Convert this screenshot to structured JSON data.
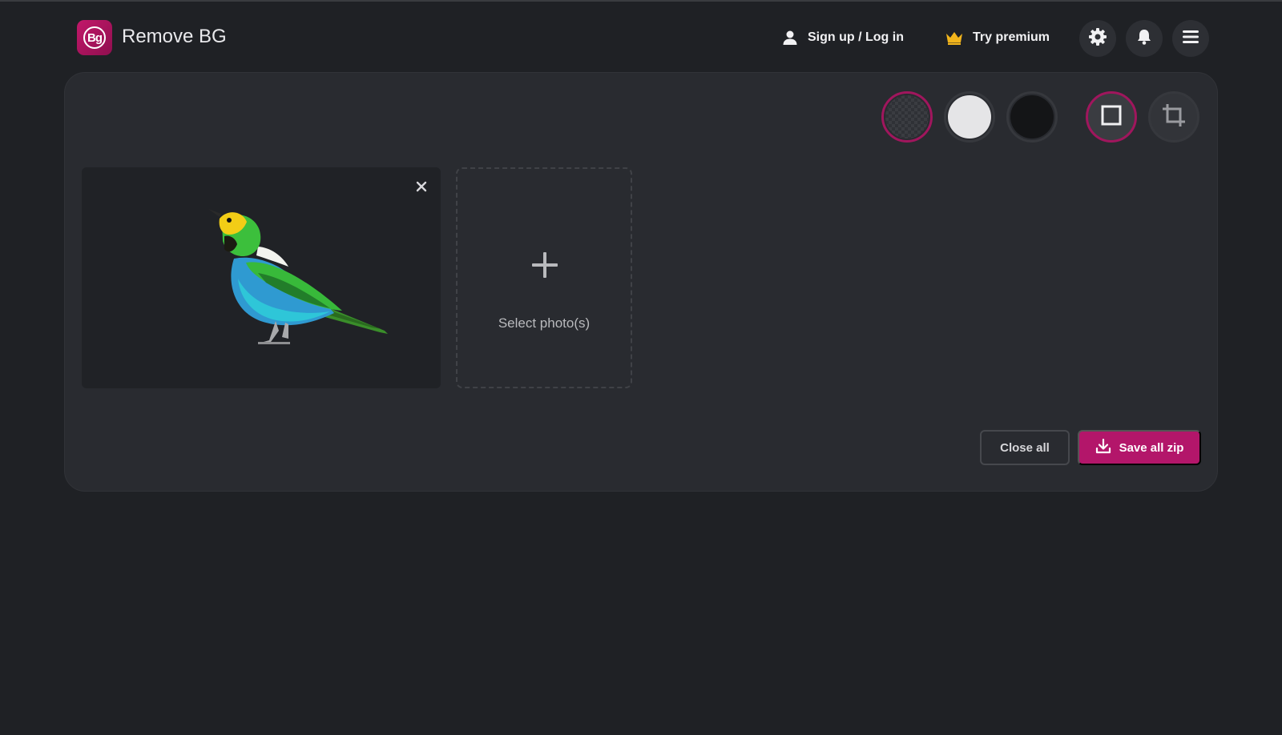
{
  "app": {
    "title": "Remove BG",
    "logo_text": "Bg"
  },
  "header": {
    "signup_label": "Sign up / Log in",
    "premium_label": "Try premium",
    "icons": [
      "user-icon",
      "crown-icon",
      "gear-icon",
      "bell-icon",
      "menu-icon"
    ]
  },
  "background_options": [
    {
      "name": "transparent",
      "selected": true
    },
    {
      "name": "white",
      "color": "#e5e5e7",
      "selected": false
    },
    {
      "name": "black",
      "color": "#141517",
      "selected": false
    }
  ],
  "tools": [
    {
      "name": "frame",
      "selected": true
    },
    {
      "name": "crop",
      "selected": false
    }
  ],
  "workspace": {
    "add_label": "Select photo(s)"
  },
  "actions": {
    "close_all_label": "Close all",
    "save_zip_label": "Save all zip"
  },
  "colors": {
    "accent": "#b3166a",
    "background": "#1f2125",
    "panel": "#292b30"
  }
}
